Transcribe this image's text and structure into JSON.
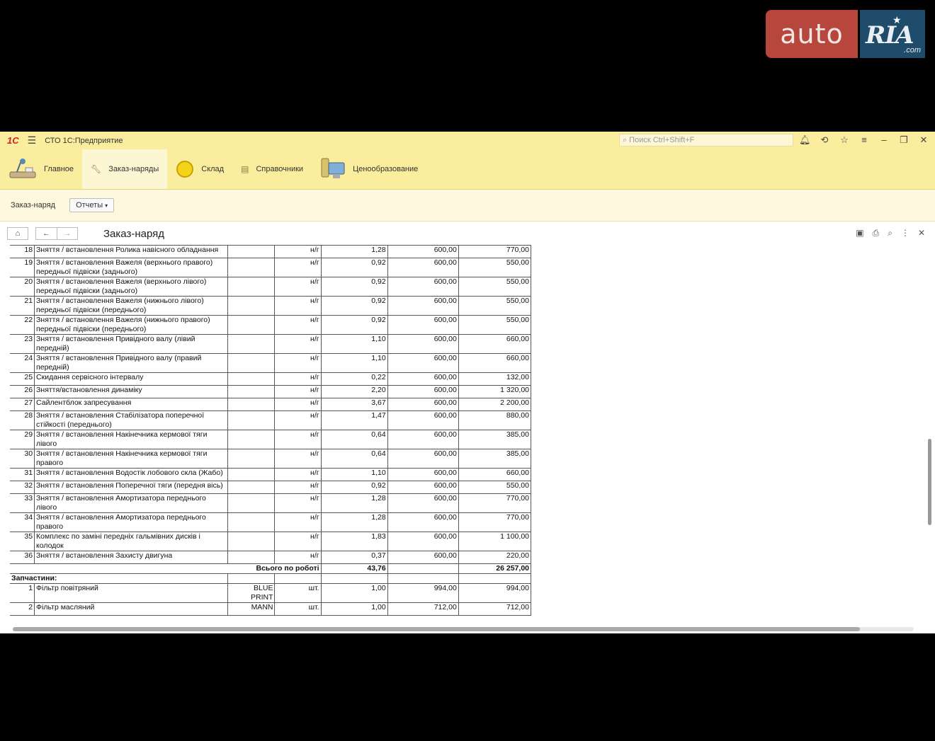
{
  "watermark": {
    "auto": "auto",
    "ria": "RIA",
    "com": ".com"
  },
  "titlebar": {
    "logo": "1С",
    "app_title": "СТО 1С:Предприятие",
    "search_placeholder": "Поиск Ctrl+Shift+F"
  },
  "sections": [
    {
      "label": "Главное",
      "icon": "desk-lamp-icon"
    },
    {
      "label": "Заказ-наряды",
      "icon": "wrench-icon",
      "active": true
    },
    {
      "label": "Склад",
      "icon": "coin-icon"
    },
    {
      "label": "Справочники",
      "icon": "books-icon"
    },
    {
      "label": "Ценообразование",
      "icon": "computer-icon"
    }
  ],
  "cmdbar": {
    "label": "Заказ-наряд",
    "reports_button": "Отчеты"
  },
  "document": {
    "title": "Заказ-наряд"
  },
  "rows": [
    {
      "n": "18",
      "name": "Зняття / встановлення Ролика навісного обладнання",
      "brand": "",
      "unit": "н/г",
      "qty": "1,28",
      "price": "600,00",
      "sum": "770,00"
    },
    {
      "n": "19",
      "name": "Зняття / встановлення Важеля (верхнього правого) передньої підвіски (заднього)",
      "brand": "",
      "unit": "н/г",
      "qty": "0,92",
      "price": "600,00",
      "sum": "550,00"
    },
    {
      "n": "20",
      "name": "Зняття / встановлення Важеля (верхнього лівого) передньої підвіски (заднього)",
      "brand": "",
      "unit": "н/г",
      "qty": "0,92",
      "price": "600,00",
      "sum": "550,00"
    },
    {
      "n": "21",
      "name": "Зняття / встановлення Важеля (нижнього лівого) передньої підвіски (переднього)",
      "brand": "",
      "unit": "н/г",
      "qty": "0,92",
      "price": "600,00",
      "sum": "550,00"
    },
    {
      "n": "22",
      "name": "Зняття / встановлення Важеля (нижнього правого) передньої підвіски (переднього)",
      "brand": "",
      "unit": "н/г",
      "qty": "0,92",
      "price": "600,00",
      "sum": "550,00"
    },
    {
      "n": "23",
      "name": "Зняття / встановлення Привідного валу (лівий передній)",
      "brand": "",
      "unit": "н/г",
      "qty": "1,10",
      "price": "600,00",
      "sum": "660,00"
    },
    {
      "n": "24",
      "name": "Зняття / встановлення Привідного валу (правий передній)",
      "brand": "",
      "unit": "н/г",
      "qty": "1,10",
      "price": "600,00",
      "sum": "660,00"
    },
    {
      "n": "25",
      "name": "Скидання сервісного інтервалу",
      "brand": "",
      "unit": "н/г",
      "qty": "0,22",
      "price": "600,00",
      "sum": "132,00"
    },
    {
      "n": "26",
      "name": "Зняття/встановлення динаміку",
      "brand": "",
      "unit": "н/г",
      "qty": "2,20",
      "price": "600,00",
      "sum": "1 320,00"
    },
    {
      "n": "27",
      "name": "Сайлентблок запресування",
      "brand": "",
      "unit": "н/г",
      "qty": "3,67",
      "price": "600,00",
      "sum": "2 200,00"
    },
    {
      "n": "28",
      "name": "Зняття / встановлення Стабілізатора поперечної стійкості (переднього)",
      "brand": "",
      "unit": "н/г",
      "qty": "1,47",
      "price": "600,00",
      "sum": "880,00"
    },
    {
      "n": "29",
      "name": "Зняття / встановлення Накінечника кермової тяги лівого",
      "brand": "",
      "unit": "н/г",
      "qty": "0,64",
      "price": "600,00",
      "sum": "385,00"
    },
    {
      "n": "30",
      "name": "Зняття / встановлення Накінечника кермової тяги правого",
      "brand": "",
      "unit": "н/г",
      "qty": "0,64",
      "price": "600,00",
      "sum": "385,00"
    },
    {
      "n": "31",
      "name": "Зняття / встановлення Водостік лобового скла (Жабо)",
      "brand": "",
      "unit": "н/г",
      "qty": "1,10",
      "price": "600,00",
      "sum": "660,00"
    },
    {
      "n": "32",
      "name": "Зняття / встановлення Поперечної тяги (передня вісь)",
      "brand": "",
      "unit": "н/г",
      "qty": "0,92",
      "price": "600,00",
      "sum": "550,00"
    },
    {
      "n": "33",
      "name": "Зняття / встановлення Амортизатора переднього лівого",
      "brand": "",
      "unit": "н/г",
      "qty": "1,28",
      "price": "600,00",
      "sum": "770,00"
    },
    {
      "n": "34",
      "name": "Зняття / встановлення Амортизатора переднього правого",
      "brand": "",
      "unit": "н/г",
      "qty": "1,28",
      "price": "600,00",
      "sum": "770,00"
    },
    {
      "n": "35",
      "name": "Комплекс по заміні передніх гальмівних дисків і колодок",
      "brand": "",
      "unit": "н/г",
      "qty": "1,83",
      "price": "600,00",
      "sum": "1 100,00"
    },
    {
      "n": "36",
      "name": "Зняття / встановлення Захисту двигуна",
      "brand": "",
      "unit": "н/г",
      "qty": "0,37",
      "price": "600,00",
      "sum": "220,00"
    }
  ],
  "total": {
    "label": "Всього по роботі",
    "qty": "43,76",
    "sum": "26 257,00"
  },
  "parts_header": "Запчастини:",
  "parts": [
    {
      "n": "1",
      "name": "Фільтр повітряний",
      "brand": "BLUE PRINT",
      "unit": "шт.",
      "qty": "1,00",
      "price": "994,00",
      "sum": "994,00"
    },
    {
      "n": "2",
      "name": "Фільтр масляний",
      "brand": "MANN",
      "unit": "шт.",
      "qty": "1,00",
      "price": "712,00",
      "sum": "712,00"
    }
  ]
}
